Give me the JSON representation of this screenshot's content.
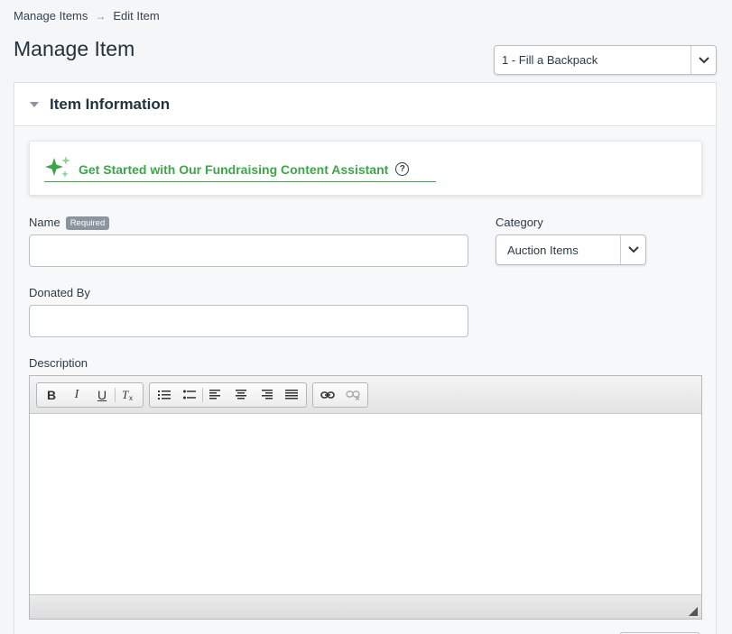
{
  "breadcrumb": {
    "items": [
      "Manage Items",
      "Edit Item"
    ],
    "separator": "→"
  },
  "page": {
    "title": "Manage Item"
  },
  "item_selector": {
    "value": "1 - Fill a Backpack"
  },
  "panel": {
    "title": "Item Information"
  },
  "assistant": {
    "label": "Get Started with Our Fundraising Content Assistant",
    "help": "?"
  },
  "form": {
    "name_label": "Name",
    "required_badge": "Required",
    "name_value": "",
    "category_label": "Category",
    "category_value": "Auction Items",
    "donated_by_label": "Donated By",
    "donated_by_value": "",
    "description_label": "Description"
  },
  "toolbar": {
    "bold": "B",
    "italic": "I",
    "underline": "U",
    "remove_format": "Tx"
  },
  "colors": {
    "accent_green": "#3ea54a",
    "text_dark": "#23323d",
    "badge_gray": "#8b959e"
  },
  "icons": [
    "arrow-right-icon",
    "chevron-down-icon",
    "caret-down-icon",
    "sparkle-icon",
    "help-circle-icon",
    "bold-icon",
    "italic-icon",
    "underline-icon",
    "remove-format-icon",
    "numbered-list-icon",
    "bulleted-list-icon",
    "align-left-icon",
    "align-center-icon",
    "align-right-icon",
    "align-justify-icon",
    "link-icon",
    "unlink-icon",
    "resize-grip-icon"
  ]
}
